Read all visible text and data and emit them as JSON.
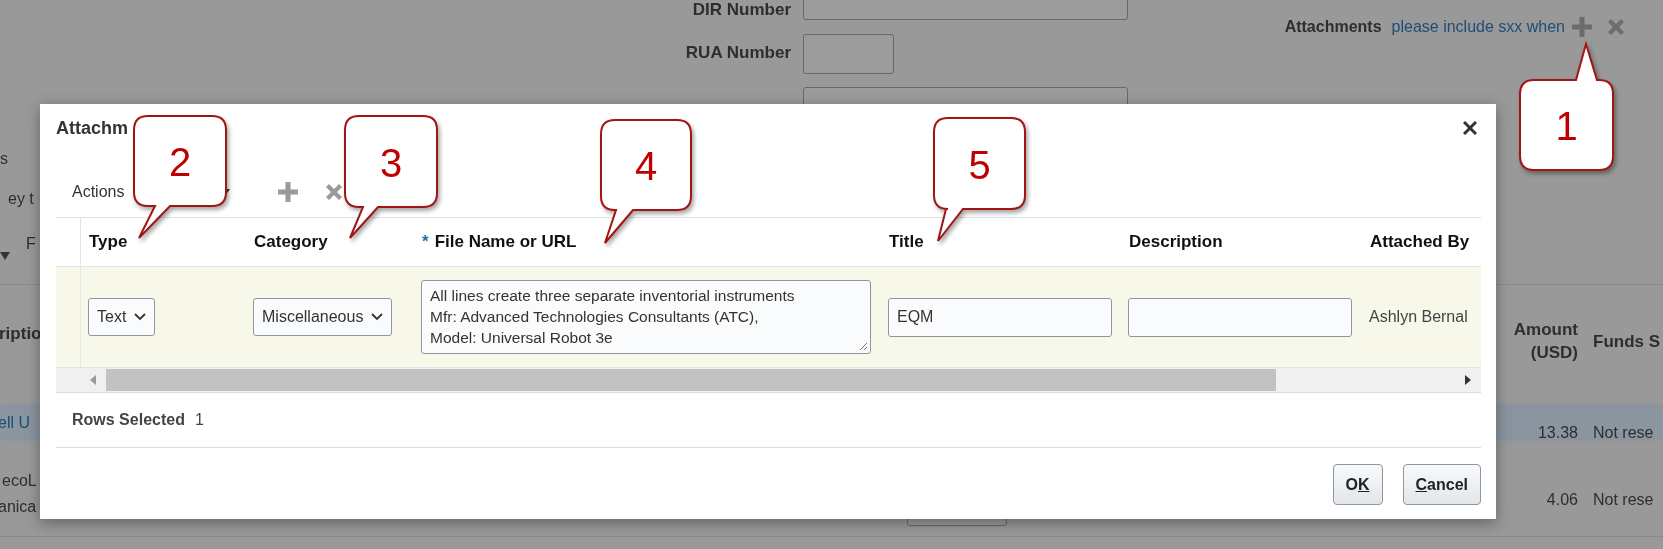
{
  "page": {
    "fields": [
      {
        "label": "DIR Number"
      },
      {
        "label": "RUA Number"
      }
    ],
    "attachments": {
      "label": "Attachments",
      "link": "please include sxx when"
    },
    "left_texts": [
      {
        "text": "s",
        "kind": "plain"
      },
      {
        "text": "ey t",
        "kind": "plain"
      },
      {
        "text": "F",
        "kind": "plain"
      },
      {
        "text": "riptio",
        "kind": "heading"
      },
      {
        "text": "ell U",
        "kind": "link"
      },
      {
        "text": "ecoL",
        "kind": "plain"
      },
      {
        "text": "anica",
        "kind": "plain"
      }
    ],
    "table": {
      "columns": [
        {
          "label": "Amount (USD)"
        },
        {
          "label": "Funds S"
        }
      ],
      "rows": [
        {
          "selected": true,
          "amount": "13.38",
          "funds_status": "Not rese"
        },
        {
          "selected": false,
          "amount": "4.06",
          "funds_status": "Not rese"
        }
      ]
    }
  },
  "dialog": {
    "title": "Attachm",
    "actions_label": "Actions",
    "columns": [
      {
        "label": "Type"
      },
      {
        "label": "Category"
      },
      {
        "label": "File Name or URL",
        "required_marker": "*"
      },
      {
        "label": "Title"
      },
      {
        "label": "Description"
      },
      {
        "label": "Attached By"
      }
    ],
    "rows": [
      {
        "selected": true,
        "type": "Text",
        "category": "Miscellaneous",
        "file_name": "All lines create three separate inventorial instruments\nMfr: Advanced Technologies Consultants (ATC),\nModel: Universal Robot 3e",
        "title": "EQM",
        "attached_by": "Ashlyn Bernal"
      }
    ],
    "rows_selected": {
      "label": "Rows Selected",
      "count": "1"
    },
    "buttons": [
      {
        "parts": [
          {
            "text": "O",
            "underlined": false
          },
          {
            "text": "K",
            "underlined": true
          }
        ]
      },
      {
        "parts": [
          {
            "text": "C",
            "underlined": true
          },
          {
            "text": "ancel",
            "underlined": false
          }
        ]
      }
    ]
  },
  "callouts": [
    {
      "number": "1"
    },
    {
      "number": "2"
    },
    {
      "number": "3"
    },
    {
      "number": "4"
    },
    {
      "number": "5"
    }
  ]
}
